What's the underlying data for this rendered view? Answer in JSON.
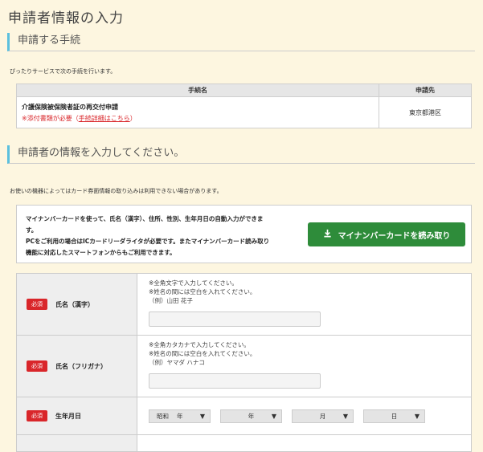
{
  "page_title": "申請者情報の入力",
  "procedure_section": {
    "heading": "申請する手続",
    "note": "ぴったりサービスで次の手続を行います。",
    "table": {
      "col_name": "手続名",
      "col_dest": "申請先",
      "rows": [
        {
          "name": "介護保険被保険者証の再交付申請",
          "required_text": "※添付書類が必要（",
          "link_text": "手続詳細はこちら",
          "required_close": "）",
          "destination": "東京都港区"
        }
      ]
    }
  },
  "applicant_section": {
    "heading": "申請者の情報を入力してください。",
    "note": "お使いの機器によってはカード券面情報の取り込みは利用できない場合があります。"
  },
  "mynumber": {
    "line1": "マイナンバーカードを使って、氏名（漢字）、住所、性別、生年月日の自動入力ができま",
    "line2": "す。",
    "line3": "PCをご利用の場合はICカードリーダライタが必要です。またマイナンバーカード読み取り",
    "line4": "機能に対応したスマートフォンからもご利用できます。",
    "button_label": "マイナンバーカードを読み取り",
    "button_color": "#2e8c3a"
  },
  "form": {
    "required_badge": "必須",
    "badge_color": "#d9262a",
    "fields": {
      "name_kanji": {
        "label": "氏名（漢字）",
        "hint1": "※全角文字で入力してください。",
        "hint2": "※姓名の間には空白を入れてください。",
        "example": "（例）山田 花子",
        "value": ""
      },
      "name_kana": {
        "label": "氏名（フリガナ）",
        "hint1": "※全角カタカナで入力してください。",
        "hint2": "※姓名の間には空白を入れてください。",
        "example": "（例）ヤマダ ハナコ",
        "value": ""
      },
      "dob": {
        "label": "生年月日",
        "era": "昭和",
        "era_year": "年",
        "year": "年",
        "month": "月",
        "day": "日"
      }
    }
  }
}
